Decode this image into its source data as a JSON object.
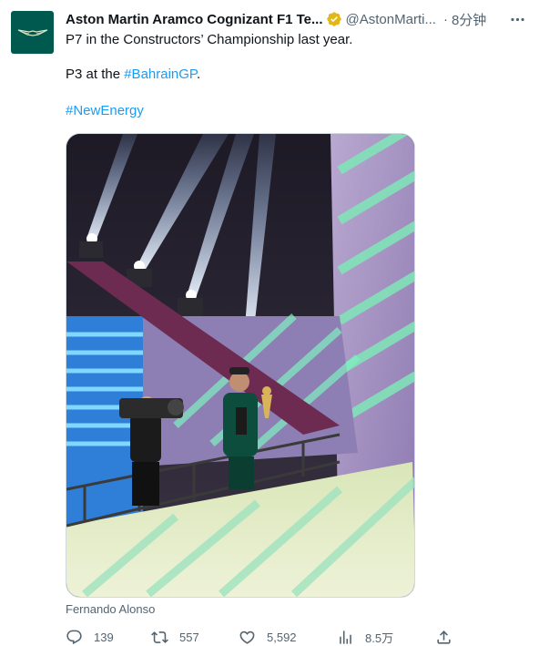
{
  "tweet": {
    "author_name": "Aston Martin Aramco Cognizant F1 Te...",
    "author_handle": "@AstonMarti...",
    "separator": "·",
    "time": "8分钟",
    "line1": "P7 in the Constructors’ Championship last year.",
    "line2_prefix": "P3 at the ",
    "line2_hashtag": "#BahrainGP",
    "line2_suffix": ".",
    "line3_hashtag": "#NewEnergy",
    "media_caption": "Fernando Alonso"
  },
  "actions": {
    "replies": "139",
    "retweets": "557",
    "likes": "5,592",
    "views": "8.5万"
  },
  "icons": {
    "avatar": "aston-martin-wings-icon",
    "verified": "verified-badge-icon",
    "more": "more-icon",
    "reply": "reply-icon",
    "retweet": "retweet-icon",
    "like": "like-icon",
    "views": "views-icon",
    "share": "share-icon"
  },
  "colors": {
    "brand": "#00594f",
    "link": "#1d9bf0",
    "secondary_text": "#536471",
    "verified_gold": "#e2b719"
  }
}
